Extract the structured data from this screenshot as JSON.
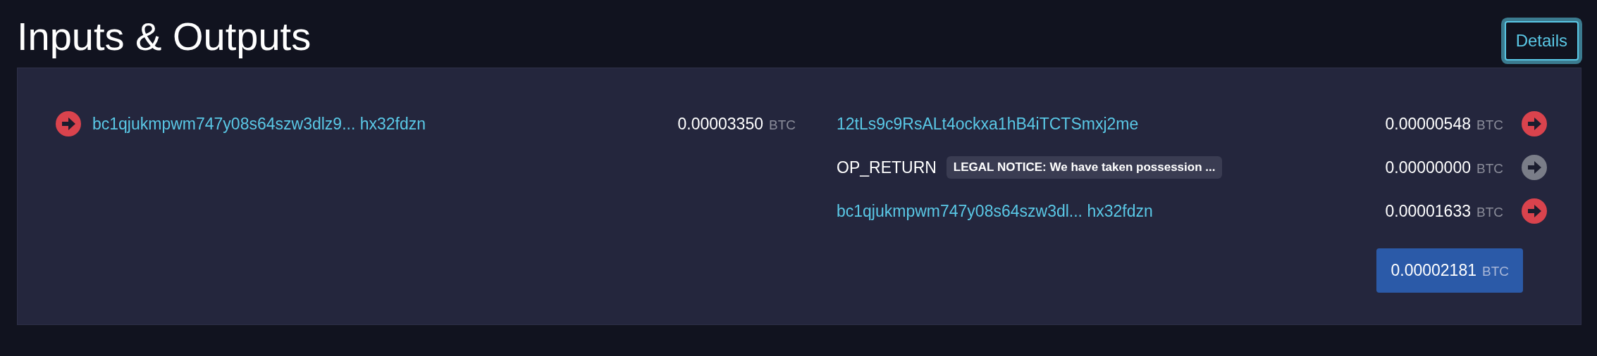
{
  "title": "Inputs & Outputs",
  "details_button": {
    "label": "Details"
  },
  "inputs": [
    {
      "address": "bc1qjukmpwm747y08s64szw3dlz9... hx32fdzn",
      "amount": "0.00003350",
      "unit": "BTC",
      "color": "#d9434d"
    }
  ],
  "outputs": [
    {
      "kind": "address",
      "address": "12tLs9c9RsALt4ockxa1hB4iTCTSmxj2me",
      "amount": "0.00000548",
      "unit": "BTC",
      "color": "#d9434d"
    },
    {
      "kind": "op_return",
      "label": "OP_RETURN",
      "message": "LEGAL NOTICE: We have taken possession ...",
      "amount": "0.00000000",
      "unit": "BTC",
      "color": "#7a7d88"
    },
    {
      "kind": "address",
      "address": "bc1qjukmpwm747y08s64szw3dl... hx32fdzn",
      "amount": "0.00001633",
      "unit": "BTC",
      "color": "#d9434d"
    }
  ],
  "total": {
    "amount": "0.00002181",
    "unit": "BTC"
  }
}
